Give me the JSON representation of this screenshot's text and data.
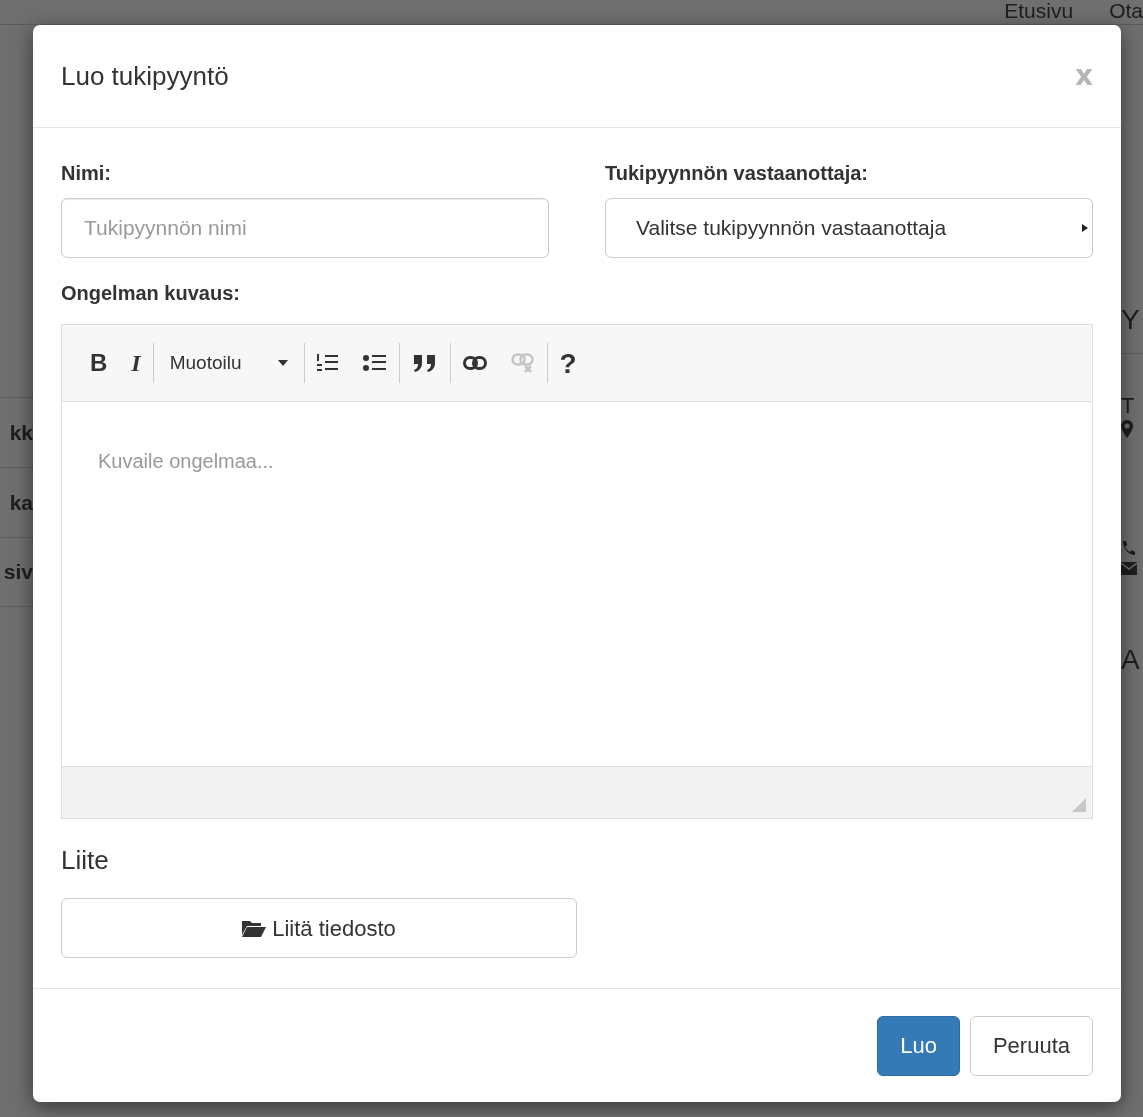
{
  "background": {
    "nav": [
      "Etusivu",
      "Ota"
    ],
    "left_column": [
      "kk",
      "ka",
      "siv"
    ],
    "right_column": [
      {
        "kind": "heading",
        "text": "Y"
      },
      {
        "kind": "contact",
        "text": "T"
      },
      {
        "kind": "heading",
        "text": "A"
      }
    ]
  },
  "dialog": {
    "title": "Luo tukipyyntö",
    "close": "x",
    "name_field": {
      "label": "Nimi:",
      "placeholder": "Tukipyynnön nimi"
    },
    "recipient_field": {
      "label": "Tukipyynnön vastaanottaja:",
      "value": "Valitse tukipyynnön vastaanottaja"
    },
    "description": {
      "label": "Ongelman kuvaus:",
      "placeholder": "Kuvaile ongelmaa...",
      "toolbar": [
        [
          {
            "kind": "bold",
            "label": "B",
            "disabled": false
          },
          {
            "kind": "italic",
            "label": "I",
            "disabled": false
          }
        ],
        [
          {
            "kind": "dropdown",
            "label": "Muotoilu",
            "disabled": false
          }
        ],
        [
          {
            "kind": "ordered",
            "disabled": false
          },
          {
            "kind": "bullets",
            "disabled": false
          }
        ],
        [
          {
            "kind": "quote",
            "disabled": false
          }
        ],
        [
          {
            "kind": "link",
            "disabled": false
          },
          {
            "kind": "unlink",
            "disabled": true
          }
        ],
        [
          {
            "kind": "help",
            "label": "?",
            "disabled": false
          }
        ]
      ]
    },
    "attachment": {
      "heading": "Liite",
      "button": "Liitä tiedosto"
    },
    "buttons": [
      {
        "label": "Luo",
        "primary": true
      },
      {
        "label": "Peruuta",
        "primary": false
      }
    ]
  }
}
